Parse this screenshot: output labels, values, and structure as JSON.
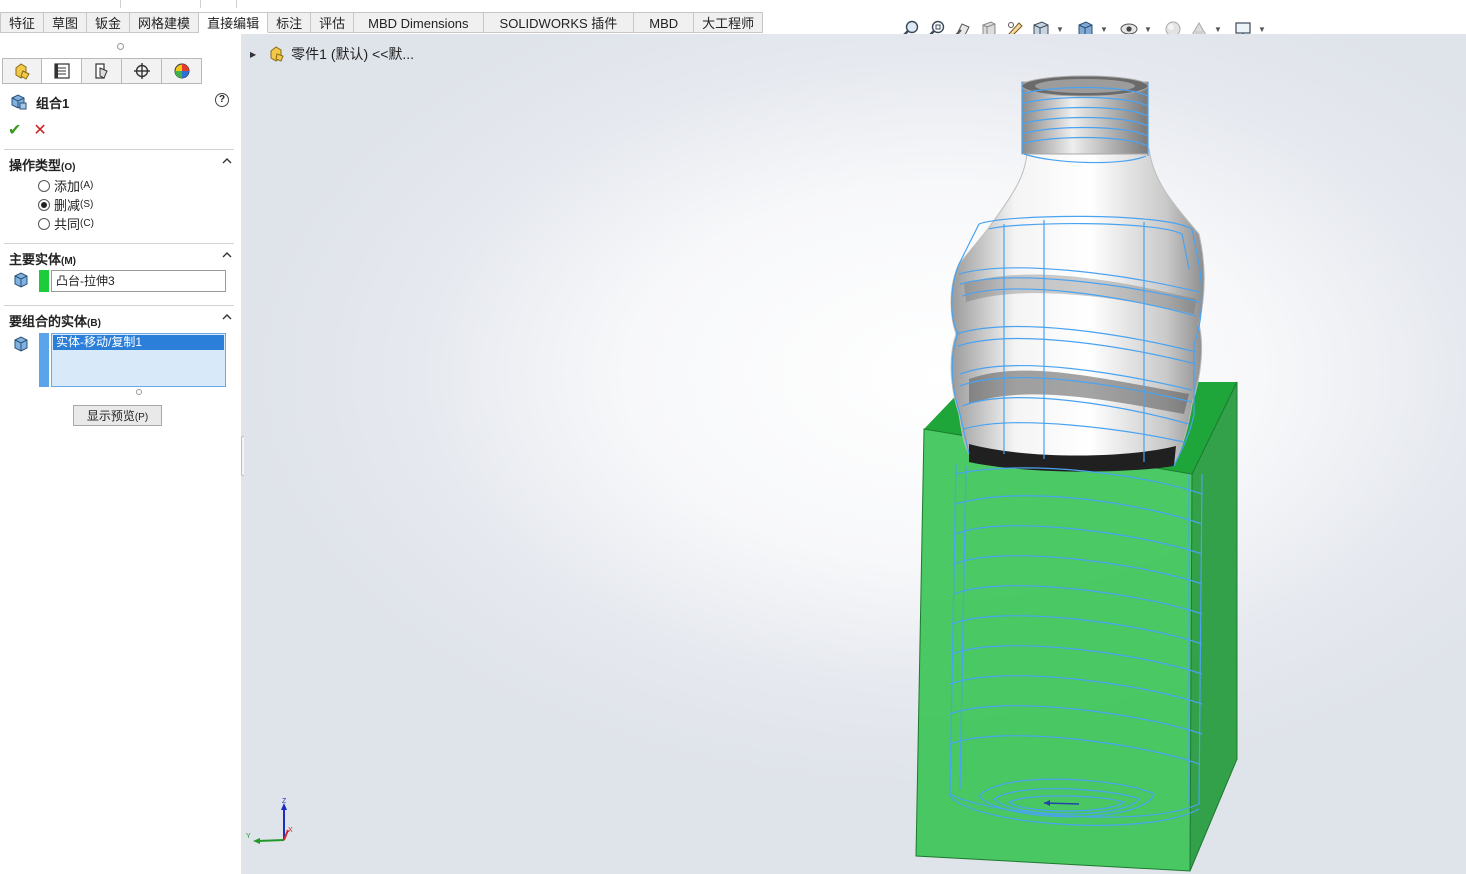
{
  "tabs": [
    "特征",
    "草图",
    "钣金",
    "网格建模",
    "直接编辑",
    "标注",
    "评估",
    "MBD Dimensions",
    "SOLIDWORKS 插件",
    "MBD",
    "大工程师"
  ],
  "active_tab": "直接编辑",
  "heads_up_toolbar": {
    "icons": [
      "zoom-to-fit-icon",
      "zoom-to-area-icon",
      "previous-view-icon",
      "section-view-icon",
      "dynamic-annotation-icon",
      "view-orientation-icon",
      "display-style-icon",
      "hide-show-items-icon",
      "edit-appearance-icon",
      "apply-scene-icon",
      "view-settings-icon"
    ]
  },
  "property_manager": {
    "tab_icons": [
      "feature-manager-icon",
      "property-manager-icon",
      "configuration-manager-icon",
      "dimxpert-manager-icon",
      "display-manager-icon"
    ],
    "title": "组合1",
    "help": "?",
    "ok": "✔",
    "cancel": "✕",
    "operation_type": {
      "heading": "操作类型",
      "heading_accel": "(O)",
      "options": [
        {
          "label": "添加",
          "accel": "(A)",
          "selected": false
        },
        {
          "label": "删减",
          "accel": "(S)",
          "selected": true
        },
        {
          "label": "共同",
          "accel": "(C)",
          "selected": false
        }
      ]
    },
    "main_body": {
      "heading": "主要实体",
      "heading_accel": "(M)",
      "value": "凸台-拉伸3"
    },
    "bodies_to_combine": {
      "heading": "要组合的实体",
      "heading_accel": "(B)",
      "items": [
        "实体-移动/复制1"
      ]
    },
    "preview_button": {
      "label": "显示预览",
      "accel": "(P)"
    }
  },
  "viewport": {
    "tree_item": "零件1 (默认) <<默...",
    "triad_labels": {
      "z": "Z",
      "y": "Y",
      "x": "X"
    }
  },
  "colors": {
    "block_green": "#2fbf4a",
    "wireframe_blue": "#4aa3f0",
    "selection_blue": "#2b7fd9"
  }
}
